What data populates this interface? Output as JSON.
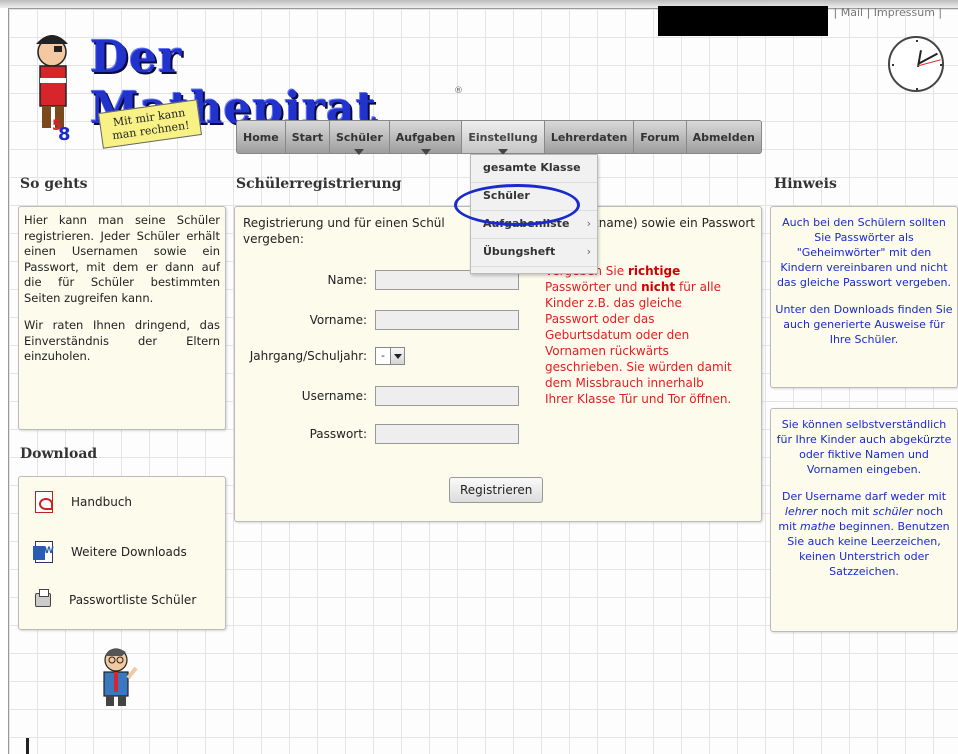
{
  "top_links": {
    "separator": "|",
    "mail": "Mail",
    "impressum": "Impressum"
  },
  "logo": {
    "title": "Der Mathepirat",
    "registered": "®",
    "slogan_line1": "Mit mir kann",
    "slogan_line2": "man rechnen!"
  },
  "nav": {
    "items": [
      {
        "label": "Home"
      },
      {
        "label": "Start"
      },
      {
        "label": "Schüler"
      },
      {
        "label": "Aufgaben"
      },
      {
        "label": "Einstellung"
      },
      {
        "label": "Lehrerdaten"
      },
      {
        "label": "Forum"
      },
      {
        "label": "Abmelden"
      }
    ],
    "active": "Einstellung"
  },
  "dropdown": {
    "items": [
      {
        "label": "gesamte Klasse"
      },
      {
        "label": "Schüler"
      },
      {
        "label": "Aufgabenliste",
        "arrow": "›"
      },
      {
        "label": "Übungsheft",
        "arrow": "›"
      }
    ]
  },
  "left": {
    "heading": "So gehts",
    "para1": "Hier kann man seine Schüler registrieren. Jeder Schüler erhält einen Usernamen sowie ein Passwort, mit dem er dann auf die für Schüler bestimmten Seiten zugreifen kann.",
    "para2": "Wir raten Ihnen dringend, das Einverständnis der Eltern einzuholen."
  },
  "download": {
    "heading": "Download",
    "items": [
      {
        "label": "Handbuch",
        "icon": "pdf-icon"
      },
      {
        "label": "Weitere Downloads",
        "icon": "word-document-icon"
      },
      {
        "label": "Passwortliste Schüler",
        "icon": "printer-icon"
      }
    ]
  },
  "center": {
    "heading": "Schülerregistrierung",
    "intro_part1": "Registrierung und für einen Schül",
    "intro_part2": "n (Nickname) sowie ein Passwort vergeben:",
    "fields": {
      "name": "Name:",
      "vorname": "Vorname:",
      "jahrgang": "Jahrgang/Schuljahr:",
      "jahrgang_value": "-",
      "username": "Username:",
      "passwort": "Passwort:"
    },
    "warning_1": "Vergeben Sie ",
    "warning_bold1": "richtige",
    "warning_2": " Passwörter und ",
    "warning_bold2": "nicht",
    "warning_3": " für alle Kinder z.B. das gleiche Passwort oder das Geburtsdatum oder den Vornamen rückwärts geschrieben. Sie würden damit dem Missbrauch innerhalb Ihrer Klasse Tür und Tor öffnen.",
    "submit": "Registrieren"
  },
  "right": {
    "heading": "Hinweis",
    "box1_p1": "Auch bei den Schülern sollten Sie Passwörter als \"Geheimwörter\" mit den Kindern vereinbaren und nicht das gleiche Passwort vergeben.",
    "box1_p2": "Unter den Downloads finden Sie auch generierte Ausweise für Ihre Schüler.",
    "box2_p1": "Sie können selbstverständlich für Ihre Kinder auch abgekürzte oder fiktive Namen und Vornamen eingeben.",
    "box2_p2_a": "Der Username darf weder mit ",
    "box2_p2_i1": "lehrer",
    "box2_p2_b": " noch mit ",
    "box2_p2_i2": "schüler",
    "box2_p2_c": " noch mit ",
    "box2_p2_i3": "mathe",
    "box2_p2_d": " beginnen. Benutzen Sie auch keine Leerzeichen, keinen Unterstrich oder Satzzeichen."
  },
  "colors": {
    "logo_blue": "#2233cc",
    "warning_red": "#dd2222",
    "hint_blue": "#1a2acc",
    "highlight_ellipse": "#1a2acc"
  }
}
